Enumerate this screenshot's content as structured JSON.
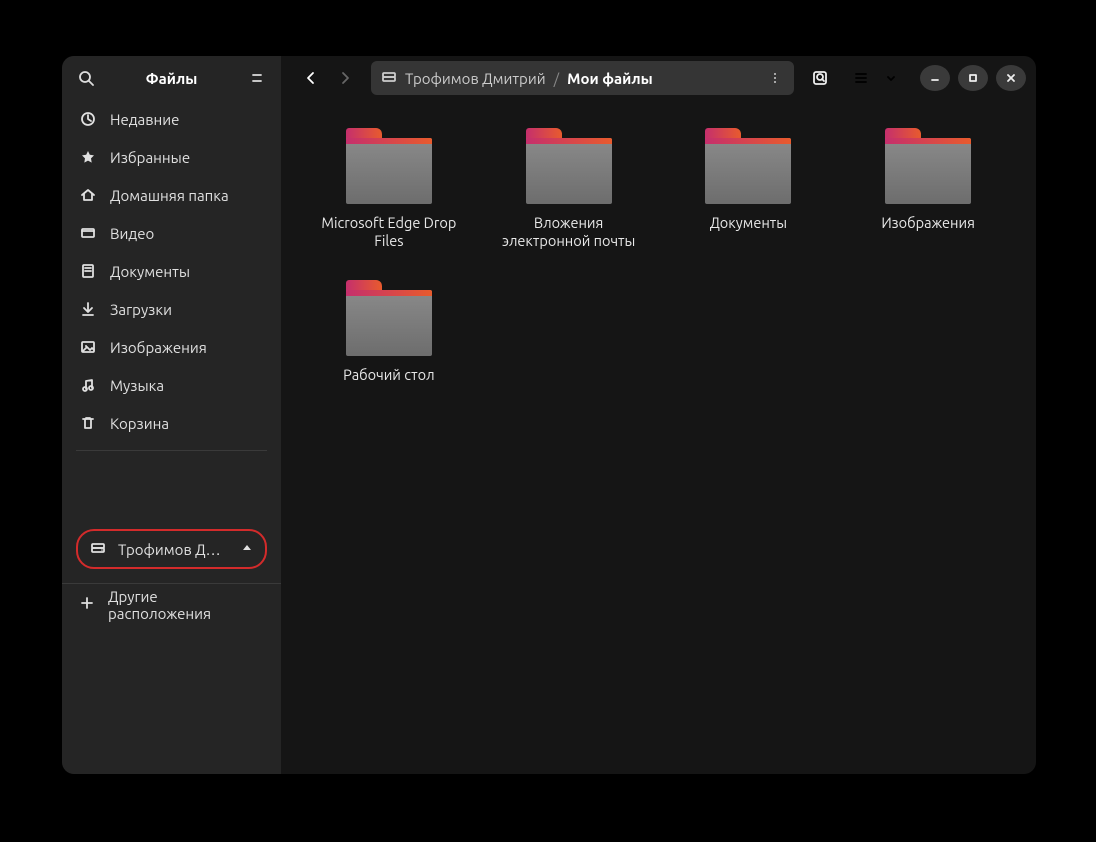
{
  "title": "Файлы",
  "sidebar": {
    "items": [
      {
        "id": "recent",
        "label": "Недавние",
        "icon": "clock-icon"
      },
      {
        "id": "starred",
        "label": "Избранные",
        "icon": "star-icon"
      },
      {
        "id": "home",
        "label": "Домашняя папка",
        "icon": "home-icon"
      },
      {
        "id": "videos",
        "label": "Видео",
        "icon": "video-icon"
      },
      {
        "id": "documents",
        "label": "Документы",
        "icon": "document-icon"
      },
      {
        "id": "downloads",
        "label": "Загрузки",
        "icon": "download-icon"
      },
      {
        "id": "pictures",
        "label": "Изображения",
        "icon": "picture-icon"
      },
      {
        "id": "music",
        "label": "Музыка",
        "icon": "music-icon"
      },
      {
        "id": "trash",
        "label": "Корзина",
        "icon": "trash-icon"
      }
    ],
    "mount": {
      "label": "Трофимов Дми…"
    },
    "other_locations_label": "Другие расположения"
  },
  "pathbar": {
    "segments": [
      {
        "label": "Трофимов Дмитрий",
        "icon": "drive-icon",
        "current": false
      },
      {
        "label": "Мои файлы",
        "current": true
      }
    ]
  },
  "folders": [
    {
      "label": "Microsoft Edge Drop Files"
    },
    {
      "label": "Вложения электронной почты"
    },
    {
      "label": "Документы"
    },
    {
      "label": "Изображения"
    },
    {
      "label": "Рабочий стол"
    }
  ]
}
